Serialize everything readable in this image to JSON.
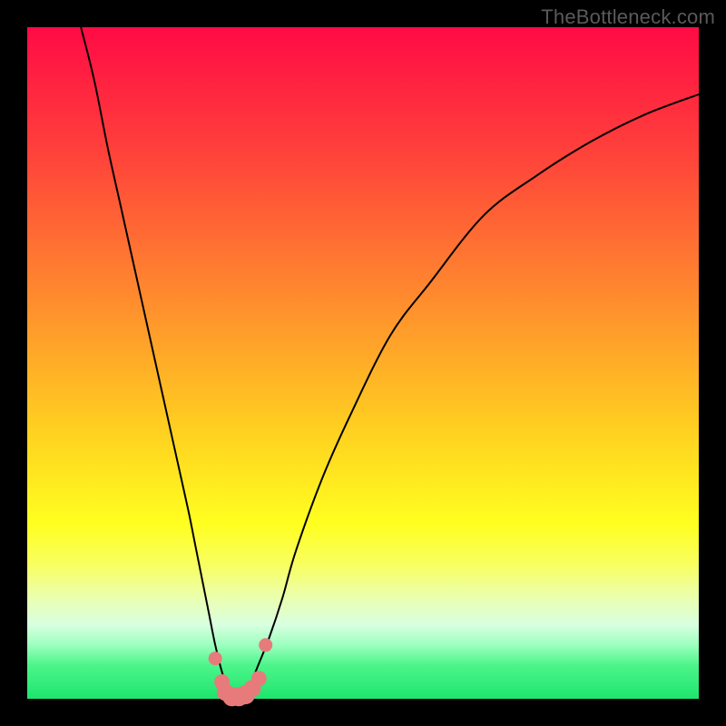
{
  "watermark": "TheBottleneck.com",
  "colors": {
    "frame": "#000000",
    "curve_stroke": "#000000",
    "marker_fill": "#e77b7b",
    "marker_stroke": "#e77b7b"
  },
  "gradient_stops": [
    {
      "offset": 0,
      "color": "#ff0b45"
    },
    {
      "offset": 18,
      "color": "#ff3f3b"
    },
    {
      "offset": 40,
      "color": "#ff8a2e"
    },
    {
      "offset": 60,
      "color": "#ffd020"
    },
    {
      "offset": 74,
      "color": "#ffff20"
    },
    {
      "offset": 80,
      "color": "#f8ff60"
    },
    {
      "offset": 85,
      "color": "#eaffb0"
    },
    {
      "offset": 89,
      "color": "#d8ffe0"
    },
    {
      "offset": 92,
      "color": "#9cffbe"
    },
    {
      "offset": 95,
      "color": "#4cf58a"
    },
    {
      "offset": 100,
      "color": "#1ee56e"
    }
  ],
  "chart_data": {
    "type": "line",
    "title": "",
    "xlabel": "",
    "ylabel": "",
    "xlim": [
      0,
      100
    ],
    "ylim": [
      0,
      100
    ],
    "series": [
      {
        "name": "bottleneck-curve",
        "x": [
          8,
          10,
          12,
          14,
          16,
          18,
          20,
          22,
          24,
          25,
          26,
          27,
          28,
          29,
          30,
          31,
          32,
          33,
          34,
          36,
          38,
          40,
          44,
          48,
          54,
          60,
          68,
          76,
          84,
          92,
          100
        ],
        "y": [
          100,
          92,
          82,
          73,
          64,
          55,
          46,
          37,
          28,
          23,
          18,
          13,
          8,
          4,
          1,
          0,
          0,
          1,
          4,
          9,
          15,
          22,
          33,
          42,
          54,
          62,
          72,
          78,
          83,
          87,
          90
        ]
      }
    ],
    "markers": {
      "name": "bottleneck-minimum-cluster",
      "x": [
        28.0,
        29.0,
        29.5,
        30.5,
        31.5,
        32.5,
        33.5,
        34.5,
        35.5
      ],
      "y": [
        6.0,
        2.5,
        1.0,
        0.3,
        0.3,
        0.6,
        1.5,
        3.0,
        8.0
      ],
      "size": [
        7,
        8,
        9,
        10,
        10,
        10,
        9,
        8,
        7
      ]
    }
  }
}
